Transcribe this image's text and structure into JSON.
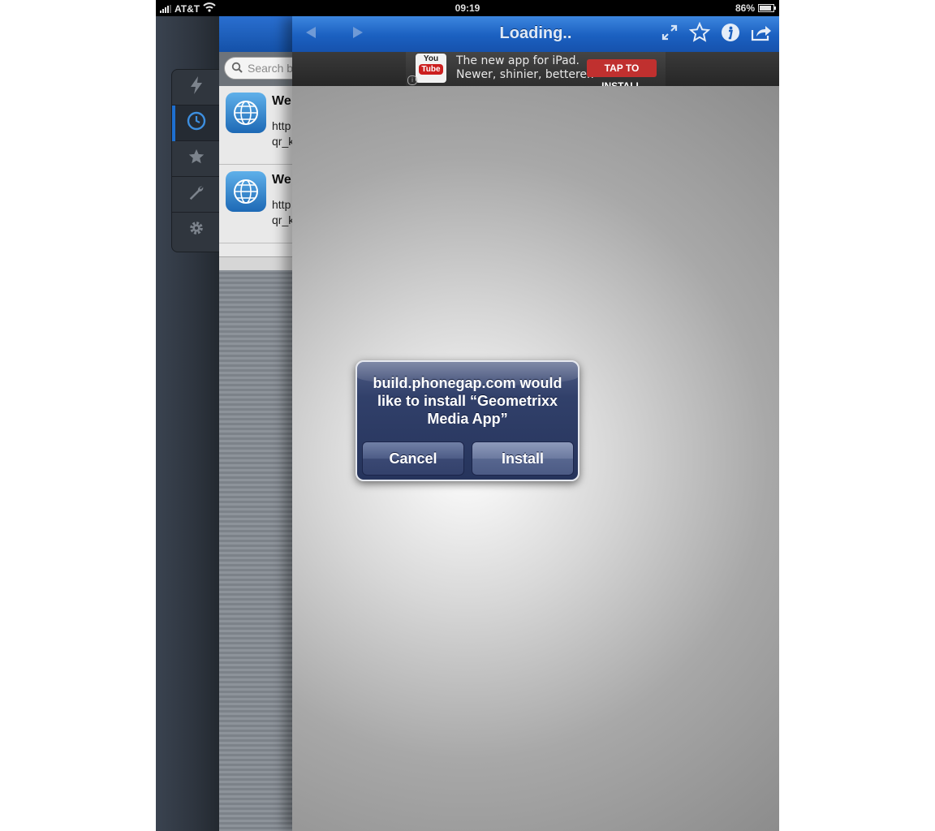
{
  "status_bar": {
    "carrier": "AT&T",
    "time": "09:19",
    "battery_percent": "86%",
    "battery_level": 0.86
  },
  "sidebar_tabs": [
    {
      "icon": "lightning-icon",
      "active": false
    },
    {
      "icon": "clock-icon",
      "active": true
    },
    {
      "icon": "star-icon",
      "active": false
    },
    {
      "icon": "wrench-icon",
      "active": false
    },
    {
      "icon": "gear-icon",
      "active": false
    }
  ],
  "history_panel": {
    "search_placeholder": "Search b",
    "items": [
      {
        "title": "We",
        "url_line1": "http",
        "url_line2": "qr_k"
      },
      {
        "title": "We",
        "url_line1": "http",
        "url_line2": "qr_k"
      }
    ]
  },
  "browser": {
    "title": "Loading..",
    "accent": "#1b60c0"
  },
  "ad": {
    "logo_you": "You",
    "logo_tube": "Tube",
    "line1": "The new app for iPad.",
    "line2": "Newer, shinier, betterer.",
    "cta": "TAP TO INSTALL",
    "cta_color": "#c0302f"
  },
  "alert": {
    "message": "build.phonegap.com would like to install “Geometrixx Media App”",
    "cancel_label": "Cancel",
    "install_label": "Install"
  }
}
